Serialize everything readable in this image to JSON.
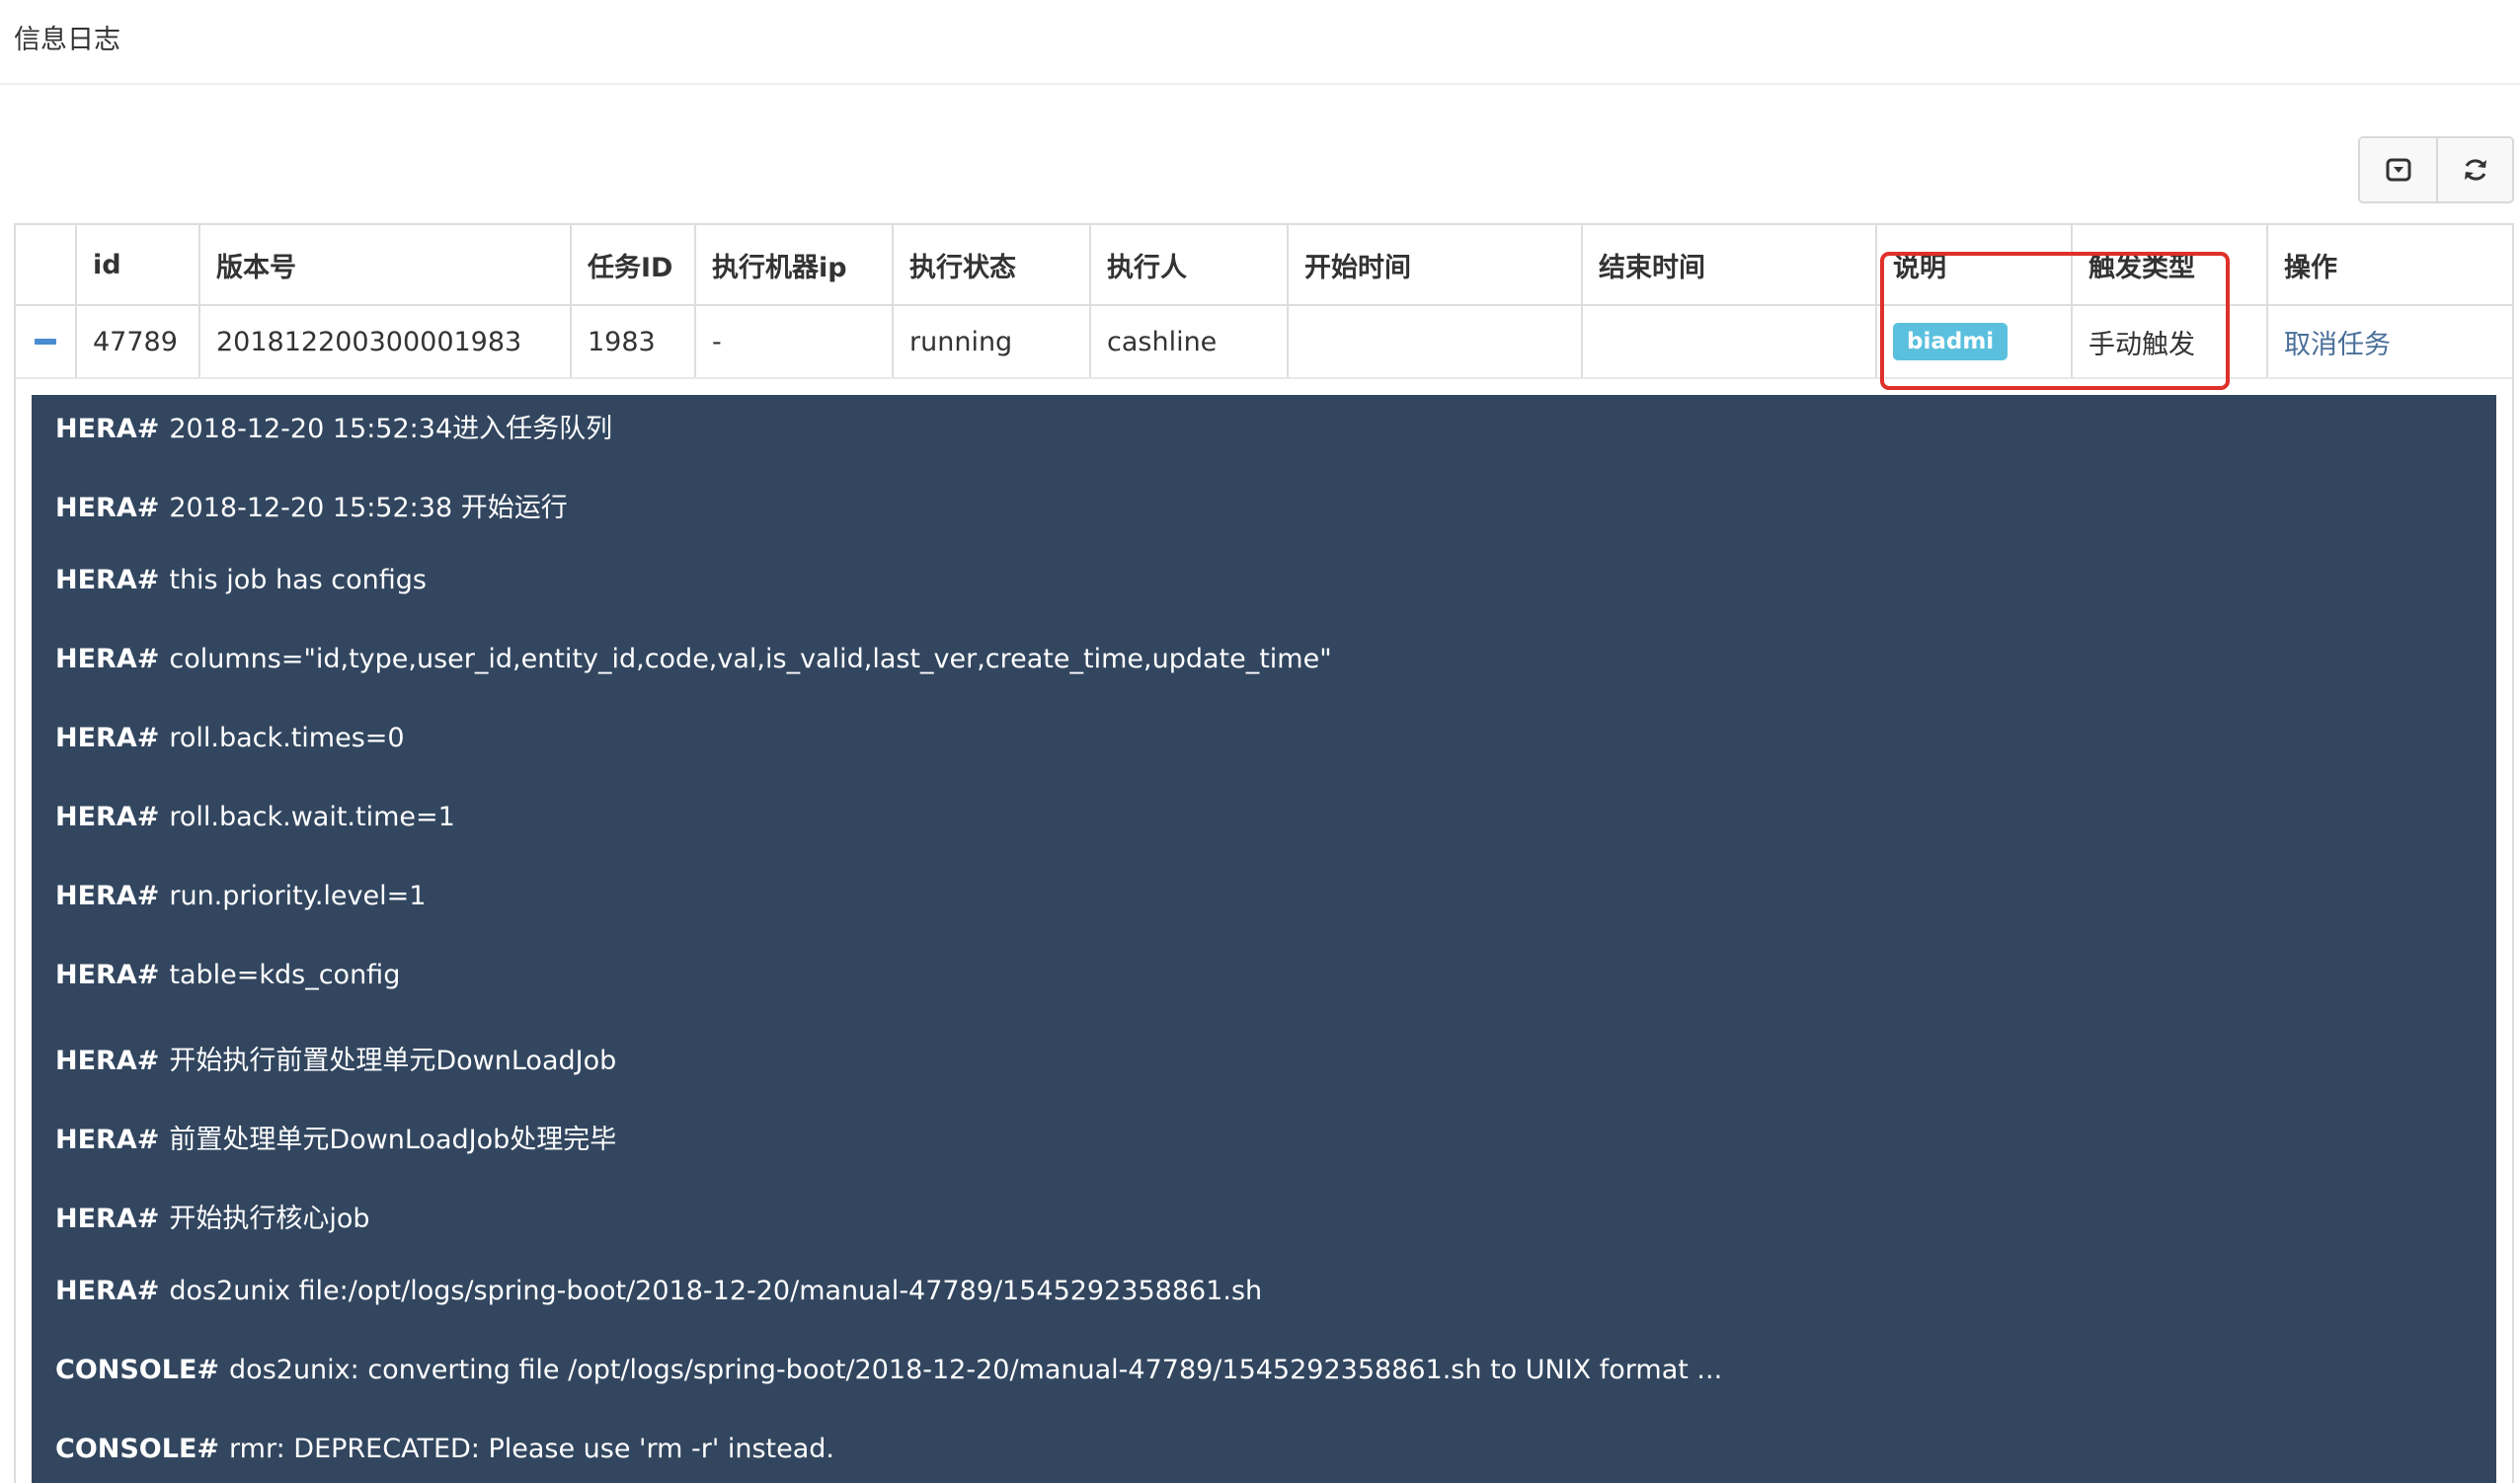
{
  "page": {
    "title": "信息日志"
  },
  "toolbar": {
    "toggle_icon": "toggle-view-icon",
    "refresh_icon": "refresh-icon"
  },
  "table": {
    "headers": [
      "",
      "id",
      "版本号",
      "任务ID",
      "执行机器ip",
      "执行状态",
      "执行人",
      "开始时间",
      "结束时间",
      "说明",
      "触发类型",
      "操作"
    ],
    "row": {
      "id": "47789",
      "version": "201812200300001983",
      "task_id": "1983",
      "machine_ip": "-",
      "status": "running",
      "executor": "cashline",
      "start_time": "",
      "end_time": "",
      "description": "biadmi",
      "trigger_type": "手动触发",
      "action": "取消任务"
    }
  },
  "colors": {
    "log_bg": "#32465f",
    "badge": "#5bc0de",
    "highlight": "#e0302a",
    "link": "#4a6f9a"
  },
  "log": [
    {
      "prefix": "HERA#",
      "text": "2018-12-20 15:52:34进入任务队列"
    },
    {
      "prefix": "HERA#",
      "text": "2018-12-20 15:52:38 开始运行"
    },
    {
      "prefix": "HERA#",
      "text": "this job has configs"
    },
    {
      "prefix": "HERA#",
      "text": "columns=\"id,type,user_id,entity_id,code,val,is_valid,last_ver,create_time,update_time\""
    },
    {
      "prefix": "HERA#",
      "text": "roll.back.times=0"
    },
    {
      "prefix": "HERA#",
      "text": "roll.back.wait.time=1"
    },
    {
      "prefix": "HERA#",
      "text": "run.priority.level=1"
    },
    {
      "prefix": "HERA#",
      "text": "table=kds_config"
    },
    {
      "prefix": "HERA#",
      "text": "开始执行前置处理单元DownLoadJob"
    },
    {
      "prefix": "HERA#",
      "text": "前置处理单元DownLoadJob处理完毕"
    },
    {
      "prefix": "HERA#",
      "text": "开始执行核心job"
    },
    {
      "prefix": "HERA#",
      "text": "dos2unix file:/opt/logs/spring-boot/2018-12-20/manual-47789/1545292358861.sh"
    },
    {
      "prefix": "CONSOLE#",
      "text": "dos2unix: converting file /opt/logs/spring-boot/2018-12-20/manual-47789/1545292358861.sh to UNIX format ..."
    },
    {
      "prefix": "CONSOLE#",
      "text": "rmr: DEPRECATED: Please use 'rm -r' instead."
    }
  ]
}
